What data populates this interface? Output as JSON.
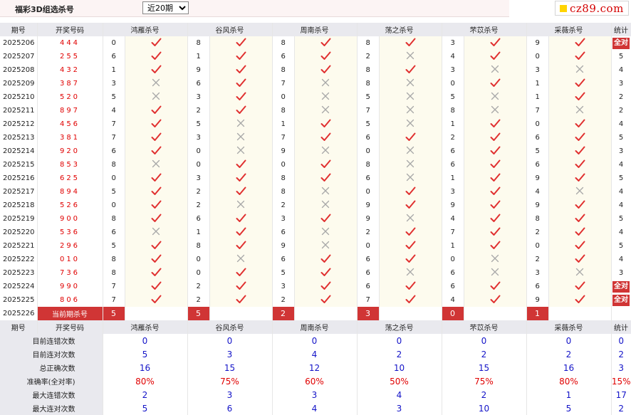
{
  "page": {
    "title": "福彩3D组选杀号",
    "period_select": {
      "value": "近20期",
      "options": [
        "近20期"
      ]
    },
    "logo_text": "cz89.com"
  },
  "table": {
    "headers": [
      "期号",
      "开奖号码",
      "鸿雁杀号",
      "谷风杀号",
      "周南杀号",
      "荡之杀号",
      "芣苡杀号",
      "采薇杀号",
      "统计"
    ],
    "rows": [
      {
        "period": "2025206",
        "draw": "444",
        "kills": [
          {
            "n": "0",
            "ok": true
          },
          {
            "n": "8",
            "ok": true
          },
          {
            "n": "8",
            "ok": true
          },
          {
            "n": "8",
            "ok": true
          },
          {
            "n": "3",
            "ok": true
          },
          {
            "n": "9",
            "ok": true
          }
        ],
        "stat": "全对"
      },
      {
        "period": "2025207",
        "draw": "255",
        "kills": [
          {
            "n": "6",
            "ok": true
          },
          {
            "n": "1",
            "ok": true
          },
          {
            "n": "6",
            "ok": true
          },
          {
            "n": "2",
            "ok": false
          },
          {
            "n": "4",
            "ok": true
          },
          {
            "n": "0",
            "ok": true
          }
        ],
        "stat": "5"
      },
      {
        "period": "2025208",
        "draw": "432",
        "kills": [
          {
            "n": "1",
            "ok": true
          },
          {
            "n": "9",
            "ok": true
          },
          {
            "n": "8",
            "ok": true
          },
          {
            "n": "8",
            "ok": true
          },
          {
            "n": "3",
            "ok": false
          },
          {
            "n": "3",
            "ok": false
          }
        ],
        "stat": "4"
      },
      {
        "period": "2025209",
        "draw": "387",
        "kills": [
          {
            "n": "3",
            "ok": false
          },
          {
            "n": "6",
            "ok": true
          },
          {
            "n": "7",
            "ok": false
          },
          {
            "n": "8",
            "ok": false
          },
          {
            "n": "0",
            "ok": true
          },
          {
            "n": "1",
            "ok": true
          }
        ],
        "stat": "3"
      },
      {
        "period": "2025210",
        "draw": "520",
        "kills": [
          {
            "n": "5",
            "ok": false
          },
          {
            "n": "3",
            "ok": true
          },
          {
            "n": "0",
            "ok": false
          },
          {
            "n": "5",
            "ok": false
          },
          {
            "n": "5",
            "ok": false
          },
          {
            "n": "1",
            "ok": true
          }
        ],
        "stat": "2"
      },
      {
        "period": "2025211",
        "draw": "897",
        "kills": [
          {
            "n": "4",
            "ok": true
          },
          {
            "n": "2",
            "ok": true
          },
          {
            "n": "8",
            "ok": false
          },
          {
            "n": "7",
            "ok": false
          },
          {
            "n": "8",
            "ok": false
          },
          {
            "n": "7",
            "ok": false
          }
        ],
        "stat": "2"
      },
      {
        "period": "2025212",
        "draw": "456",
        "kills": [
          {
            "n": "7",
            "ok": true
          },
          {
            "n": "5",
            "ok": false
          },
          {
            "n": "1",
            "ok": true
          },
          {
            "n": "5",
            "ok": false
          },
          {
            "n": "1",
            "ok": true
          },
          {
            "n": "0",
            "ok": true
          }
        ],
        "stat": "4"
      },
      {
        "period": "2025213",
        "draw": "381",
        "kills": [
          {
            "n": "7",
            "ok": true
          },
          {
            "n": "3",
            "ok": false
          },
          {
            "n": "7",
            "ok": true
          },
          {
            "n": "6",
            "ok": true
          },
          {
            "n": "2",
            "ok": true
          },
          {
            "n": "6",
            "ok": true
          }
        ],
        "stat": "5"
      },
      {
        "period": "2025214",
        "draw": "920",
        "kills": [
          {
            "n": "6",
            "ok": true
          },
          {
            "n": "0",
            "ok": false
          },
          {
            "n": "9",
            "ok": false
          },
          {
            "n": "0",
            "ok": false
          },
          {
            "n": "6",
            "ok": true
          },
          {
            "n": "5",
            "ok": true
          }
        ],
        "stat": "3"
      },
      {
        "period": "2025215",
        "draw": "853",
        "kills": [
          {
            "n": "8",
            "ok": false
          },
          {
            "n": "0",
            "ok": true
          },
          {
            "n": "0",
            "ok": true
          },
          {
            "n": "8",
            "ok": false
          },
          {
            "n": "6",
            "ok": true
          },
          {
            "n": "6",
            "ok": true
          }
        ],
        "stat": "4"
      },
      {
        "period": "2025216",
        "draw": "625",
        "kills": [
          {
            "n": "0",
            "ok": true
          },
          {
            "n": "3",
            "ok": true
          },
          {
            "n": "8",
            "ok": true
          },
          {
            "n": "6",
            "ok": false
          },
          {
            "n": "1",
            "ok": true
          },
          {
            "n": "9",
            "ok": true
          }
        ],
        "stat": "5"
      },
      {
        "period": "2025217",
        "draw": "894",
        "kills": [
          {
            "n": "5",
            "ok": true
          },
          {
            "n": "2",
            "ok": true
          },
          {
            "n": "8",
            "ok": false
          },
          {
            "n": "0",
            "ok": true
          },
          {
            "n": "3",
            "ok": true
          },
          {
            "n": "4",
            "ok": false
          }
        ],
        "stat": "4"
      },
      {
        "period": "2025218",
        "draw": "526",
        "kills": [
          {
            "n": "0",
            "ok": true
          },
          {
            "n": "2",
            "ok": false
          },
          {
            "n": "2",
            "ok": false
          },
          {
            "n": "9",
            "ok": true
          },
          {
            "n": "9",
            "ok": true
          },
          {
            "n": "9",
            "ok": true
          }
        ],
        "stat": "4"
      },
      {
        "period": "2025219",
        "draw": "900",
        "kills": [
          {
            "n": "8",
            "ok": true
          },
          {
            "n": "6",
            "ok": true
          },
          {
            "n": "3",
            "ok": true
          },
          {
            "n": "9",
            "ok": false
          },
          {
            "n": "4",
            "ok": true
          },
          {
            "n": "8",
            "ok": true
          }
        ],
        "stat": "5"
      },
      {
        "period": "2025220",
        "draw": "536",
        "kills": [
          {
            "n": "6",
            "ok": false
          },
          {
            "n": "1",
            "ok": true
          },
          {
            "n": "6",
            "ok": false
          },
          {
            "n": "2",
            "ok": true
          },
          {
            "n": "7",
            "ok": true
          },
          {
            "n": "2",
            "ok": true
          }
        ],
        "stat": "4"
      },
      {
        "period": "2025221",
        "draw": "296",
        "kills": [
          {
            "n": "5",
            "ok": true
          },
          {
            "n": "8",
            "ok": true
          },
          {
            "n": "9",
            "ok": false
          },
          {
            "n": "0",
            "ok": true
          },
          {
            "n": "1",
            "ok": true
          },
          {
            "n": "0",
            "ok": true
          }
        ],
        "stat": "5"
      },
      {
        "period": "2025222",
        "draw": "010",
        "kills": [
          {
            "n": "8",
            "ok": true
          },
          {
            "n": "0",
            "ok": false
          },
          {
            "n": "6",
            "ok": true
          },
          {
            "n": "6",
            "ok": true
          },
          {
            "n": "0",
            "ok": false
          },
          {
            "n": "2",
            "ok": true
          }
        ],
        "stat": "4"
      },
      {
        "period": "2025223",
        "draw": "736",
        "kills": [
          {
            "n": "8",
            "ok": true
          },
          {
            "n": "0",
            "ok": true
          },
          {
            "n": "5",
            "ok": true
          },
          {
            "n": "6",
            "ok": false
          },
          {
            "n": "6",
            "ok": false
          },
          {
            "n": "3",
            "ok": false
          }
        ],
        "stat": "3"
      },
      {
        "period": "2025224",
        "draw": "990",
        "kills": [
          {
            "n": "7",
            "ok": true
          },
          {
            "n": "2",
            "ok": true
          },
          {
            "n": "3",
            "ok": true
          },
          {
            "n": "6",
            "ok": true
          },
          {
            "n": "6",
            "ok": true
          },
          {
            "n": "6",
            "ok": true
          }
        ],
        "stat": "全对"
      },
      {
        "period": "2025225",
        "draw": "806",
        "kills": [
          {
            "n": "7",
            "ok": true
          },
          {
            "n": "2",
            "ok": true
          },
          {
            "n": "2",
            "ok": true
          },
          {
            "n": "7",
            "ok": true
          },
          {
            "n": "4",
            "ok": true
          },
          {
            "n": "9",
            "ok": true
          }
        ],
        "stat": "全对"
      }
    ],
    "current": {
      "period": "2025226",
      "label": "当前期杀号",
      "kills": [
        "5",
        "5",
        "2",
        "3",
        "0",
        "1"
      ]
    }
  },
  "summary": {
    "headers": [
      "期号",
      "开奖号码",
      "鸿雁杀号",
      "谷风杀号",
      "周南杀号",
      "荡之杀号",
      "芣苡杀号",
      "采薇杀号",
      "统计"
    ],
    "rows": [
      {
        "label": "目前连错次数",
        "values": [
          "0",
          "0",
          "0",
          "0",
          "0",
          "0",
          "0"
        ],
        "color": "blue"
      },
      {
        "label": "目前连对次数",
        "values": [
          "5",
          "3",
          "4",
          "2",
          "2",
          "2",
          "2"
        ],
        "color": "blue"
      },
      {
        "label": "总正确次数",
        "values": [
          "16",
          "15",
          "12",
          "10",
          "15",
          "16",
          "3"
        ],
        "color": "blue"
      },
      {
        "label": "准确率(全对率)",
        "values": [
          "80%",
          "75%",
          "60%",
          "50%",
          "75%",
          "80%",
          "15%"
        ],
        "color": "red"
      },
      {
        "label": "最大连错次数",
        "values": [
          "2",
          "3",
          "3",
          "4",
          "2",
          "1",
          "17"
        ],
        "color": "blue"
      },
      {
        "label": "最大连对次数",
        "values": [
          "5",
          "6",
          "4",
          "3",
          "10",
          "5",
          "2"
        ],
        "color": "blue"
      }
    ]
  }
}
